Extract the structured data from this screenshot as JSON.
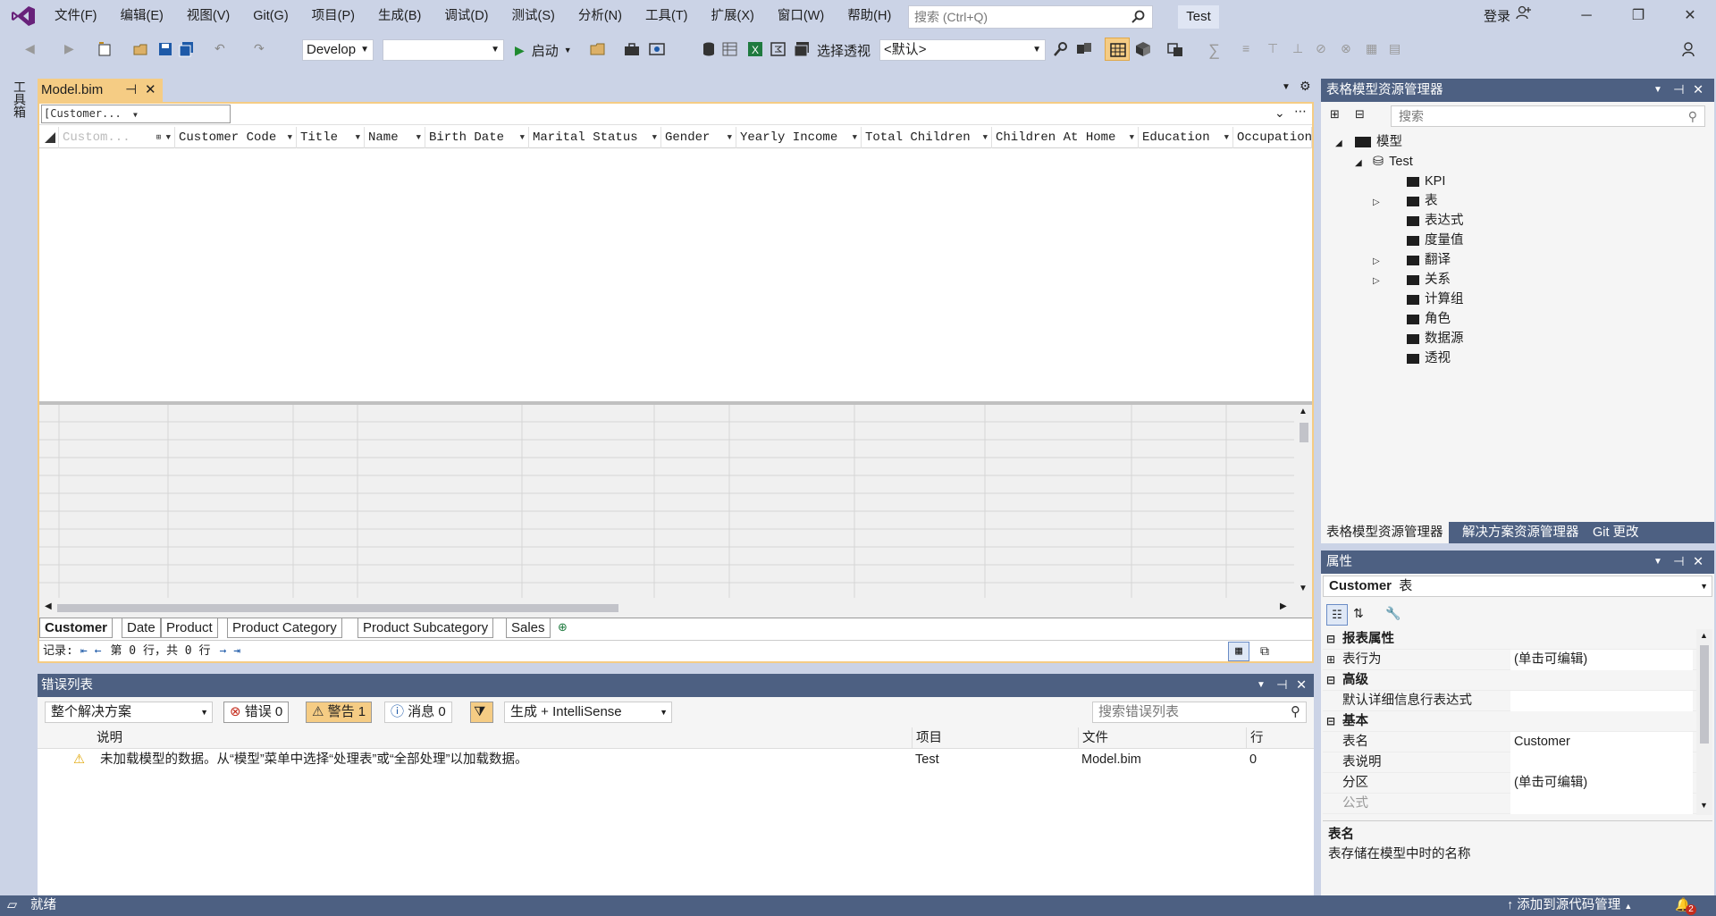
{
  "menu": {
    "items": [
      "文件(F)",
      "编辑(E)",
      "视图(V)",
      "Git(G)",
      "项目(P)",
      "生成(B)",
      "调试(D)",
      "测试(S)",
      "分析(N)",
      "工具(T)",
      "扩展(X)",
      "窗口(W)",
      "帮助(H)"
    ],
    "search_placeholder": "搜索 (Ctrl+Q)",
    "solution_name": "Test",
    "login": "登录"
  },
  "toolbar": {
    "config_combo": "Develop",
    "platform_combo": "",
    "start_label": "启动",
    "select_perspective_label": "选择透视",
    "perspective_combo": "<默认>"
  },
  "left_strip": {
    "toolbox": "工具箱"
  },
  "document": {
    "tab_title": "Model.bim",
    "column_selector": "[Customer...",
    "columns": [
      "Custom...",
      "Customer Code",
      "Title",
      "Name",
      "Birth Date",
      "Marital Status",
      "Gender",
      "Yearly Income",
      "Total Children",
      "Children At Home",
      "Education",
      "Occupation"
    ],
    "sheets": [
      "Customer",
      "Date",
      "Product",
      "Product Category",
      "Product Subcategory",
      "Sales"
    ],
    "record_label": "记录:",
    "record_text": "第 0 行，共 0 行"
  },
  "tabular_explorer": {
    "title": "表格模型资源管理器",
    "search_placeholder": "搜索",
    "root": "模型",
    "model": "Test",
    "nodes": [
      {
        "label": "KPI",
        "expandable": false
      },
      {
        "label": "表",
        "expandable": true
      },
      {
        "label": "表达式",
        "expandable": false
      },
      {
        "label": "度量值",
        "expandable": false
      },
      {
        "label": "翻译",
        "expandable": true
      },
      {
        "label": "关系",
        "expandable": true
      },
      {
        "label": "计算组",
        "expandable": false
      },
      {
        "label": "角色",
        "expandable": false
      },
      {
        "label": "数据源",
        "expandable": false
      },
      {
        "label": "透视",
        "expandable": false
      }
    ],
    "bottom_tabs": [
      "表格模型资源管理器",
      "解决方案资源管理器",
      "Git 更改"
    ]
  },
  "properties": {
    "title": "属性",
    "object_name": "Customer",
    "object_type": "表",
    "rows": [
      {
        "type": "category",
        "label": "报表属性"
      },
      {
        "type": "prop",
        "label": "表行为",
        "value": "(单击可编辑)",
        "expandable": true
      },
      {
        "type": "category",
        "label": "高级"
      },
      {
        "type": "prop",
        "label": "默认详细信息行表达式",
        "value": ""
      },
      {
        "type": "category",
        "label": "基本"
      },
      {
        "type": "prop",
        "label": "表名",
        "value": "Customer"
      },
      {
        "type": "prop",
        "label": "表说明",
        "value": ""
      },
      {
        "type": "prop",
        "label": "分区",
        "value": "(单击可编辑)"
      },
      {
        "type": "prop",
        "label": "公式",
        "value": "",
        "disabled": true
      }
    ],
    "desc_title": "表名",
    "desc_text": "表存储在模型中时的名称"
  },
  "error_list": {
    "title": "错误列表",
    "scope": "整个解决方案",
    "errors_label": "错误 0",
    "warnings_label": "警告 1",
    "messages_label": "消息 0",
    "build_filter": "生成 + IntelliSense",
    "search_placeholder": "搜索错误列表",
    "columns": [
      "说明",
      "项目",
      "文件",
      "行"
    ],
    "rows": [
      {
        "desc": "未加载模型的数据。从“模型”菜单中选择“处理表”或“全部处理”以加载数据。",
        "project": "Test",
        "file": "Model.bim",
        "line": "0"
      }
    ]
  },
  "status": {
    "ready": "就绪",
    "source_control": "添加到源代码管理",
    "notif_count": "2"
  },
  "colors": {
    "accent": "#4d6082",
    "chrome": "#cbd3e6",
    "doc_tab": "#f5cc84",
    "vs_purple": "#68217a"
  }
}
